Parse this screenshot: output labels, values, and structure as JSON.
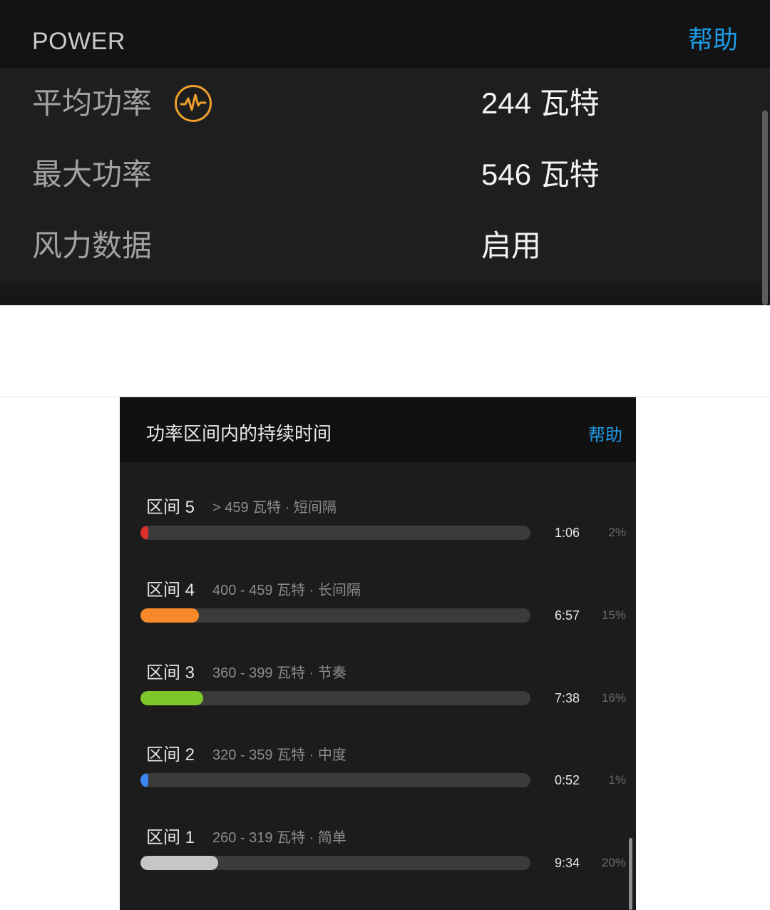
{
  "power": {
    "title": "POWER",
    "help_label": "帮助",
    "rows": [
      {
        "label": "平均功率",
        "value": "244 瓦特",
        "icon": "power-pulse-icon"
      },
      {
        "label": "最大功率",
        "value": "546 瓦特"
      },
      {
        "label": "风力数据",
        "value": "启用"
      }
    ]
  },
  "zones": {
    "title": "功率区间内的持续时间",
    "help_label": "帮助",
    "items": [
      {
        "name": "区间 5",
        "range": "> 459 瓦特 · 短间隔",
        "time": "1:06",
        "percent_label": "2%",
        "fill_pct": 2,
        "color": "#d8312a"
      },
      {
        "name": "区间 4",
        "range": "400 - 459 瓦特 · 长间隔",
        "time": "6:57",
        "percent_label": "15%",
        "fill_pct": 15,
        "color": "#f7892b"
      },
      {
        "name": "区间 3",
        "range": "360 - 399 瓦特 · 节奏",
        "time": "7:38",
        "percent_label": "16%",
        "fill_pct": 16,
        "color": "#7fc62a"
      },
      {
        "name": "区间 2",
        "range": "320 - 359 瓦特 · 中度",
        "time": "0:52",
        "percent_label": "1%",
        "fill_pct": 1,
        "color": "#3a86ee"
      },
      {
        "name": "区间 1",
        "range": "260 - 319 瓦特 · 简单",
        "time": "9:34",
        "percent_label": "20%",
        "fill_pct": 20,
        "color": "#c6c6c6"
      }
    ]
  },
  "colors": {
    "accent": "#1e9be6",
    "icon": "#f0a02c",
    "track": "#3b3b3b"
  }
}
